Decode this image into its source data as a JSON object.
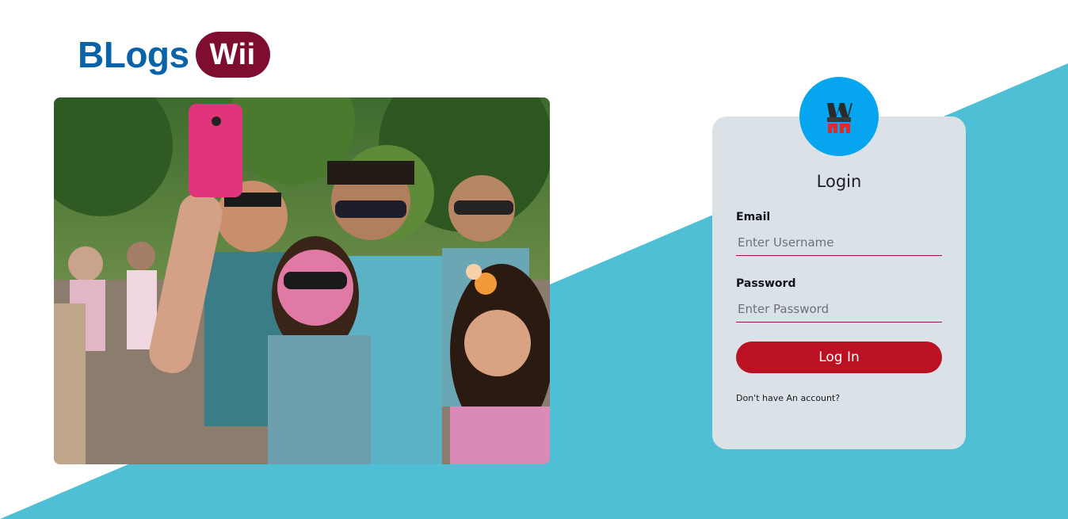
{
  "brand": {
    "name_left": "BLogs",
    "name_right": "Wii"
  },
  "login": {
    "title": "Login",
    "email_label": "Email",
    "email_placeholder": "Enter Username",
    "password_label": "Password",
    "password_placeholder": "Enter Password",
    "button_label": "Log In",
    "signup_prompt": "Don't have An account?"
  },
  "colors": {
    "brand_blue": "#0a63a8",
    "brand_pill": "#7e0d2f",
    "accent_teal": "#4fbfd5",
    "avatar_blue": "#06a5ef",
    "card_bg": "#dae2e8",
    "button_red": "#ba1222",
    "input_underline": "#8b1a5a"
  },
  "icons": {
    "avatar_logo": "bw-logo-icon"
  }
}
